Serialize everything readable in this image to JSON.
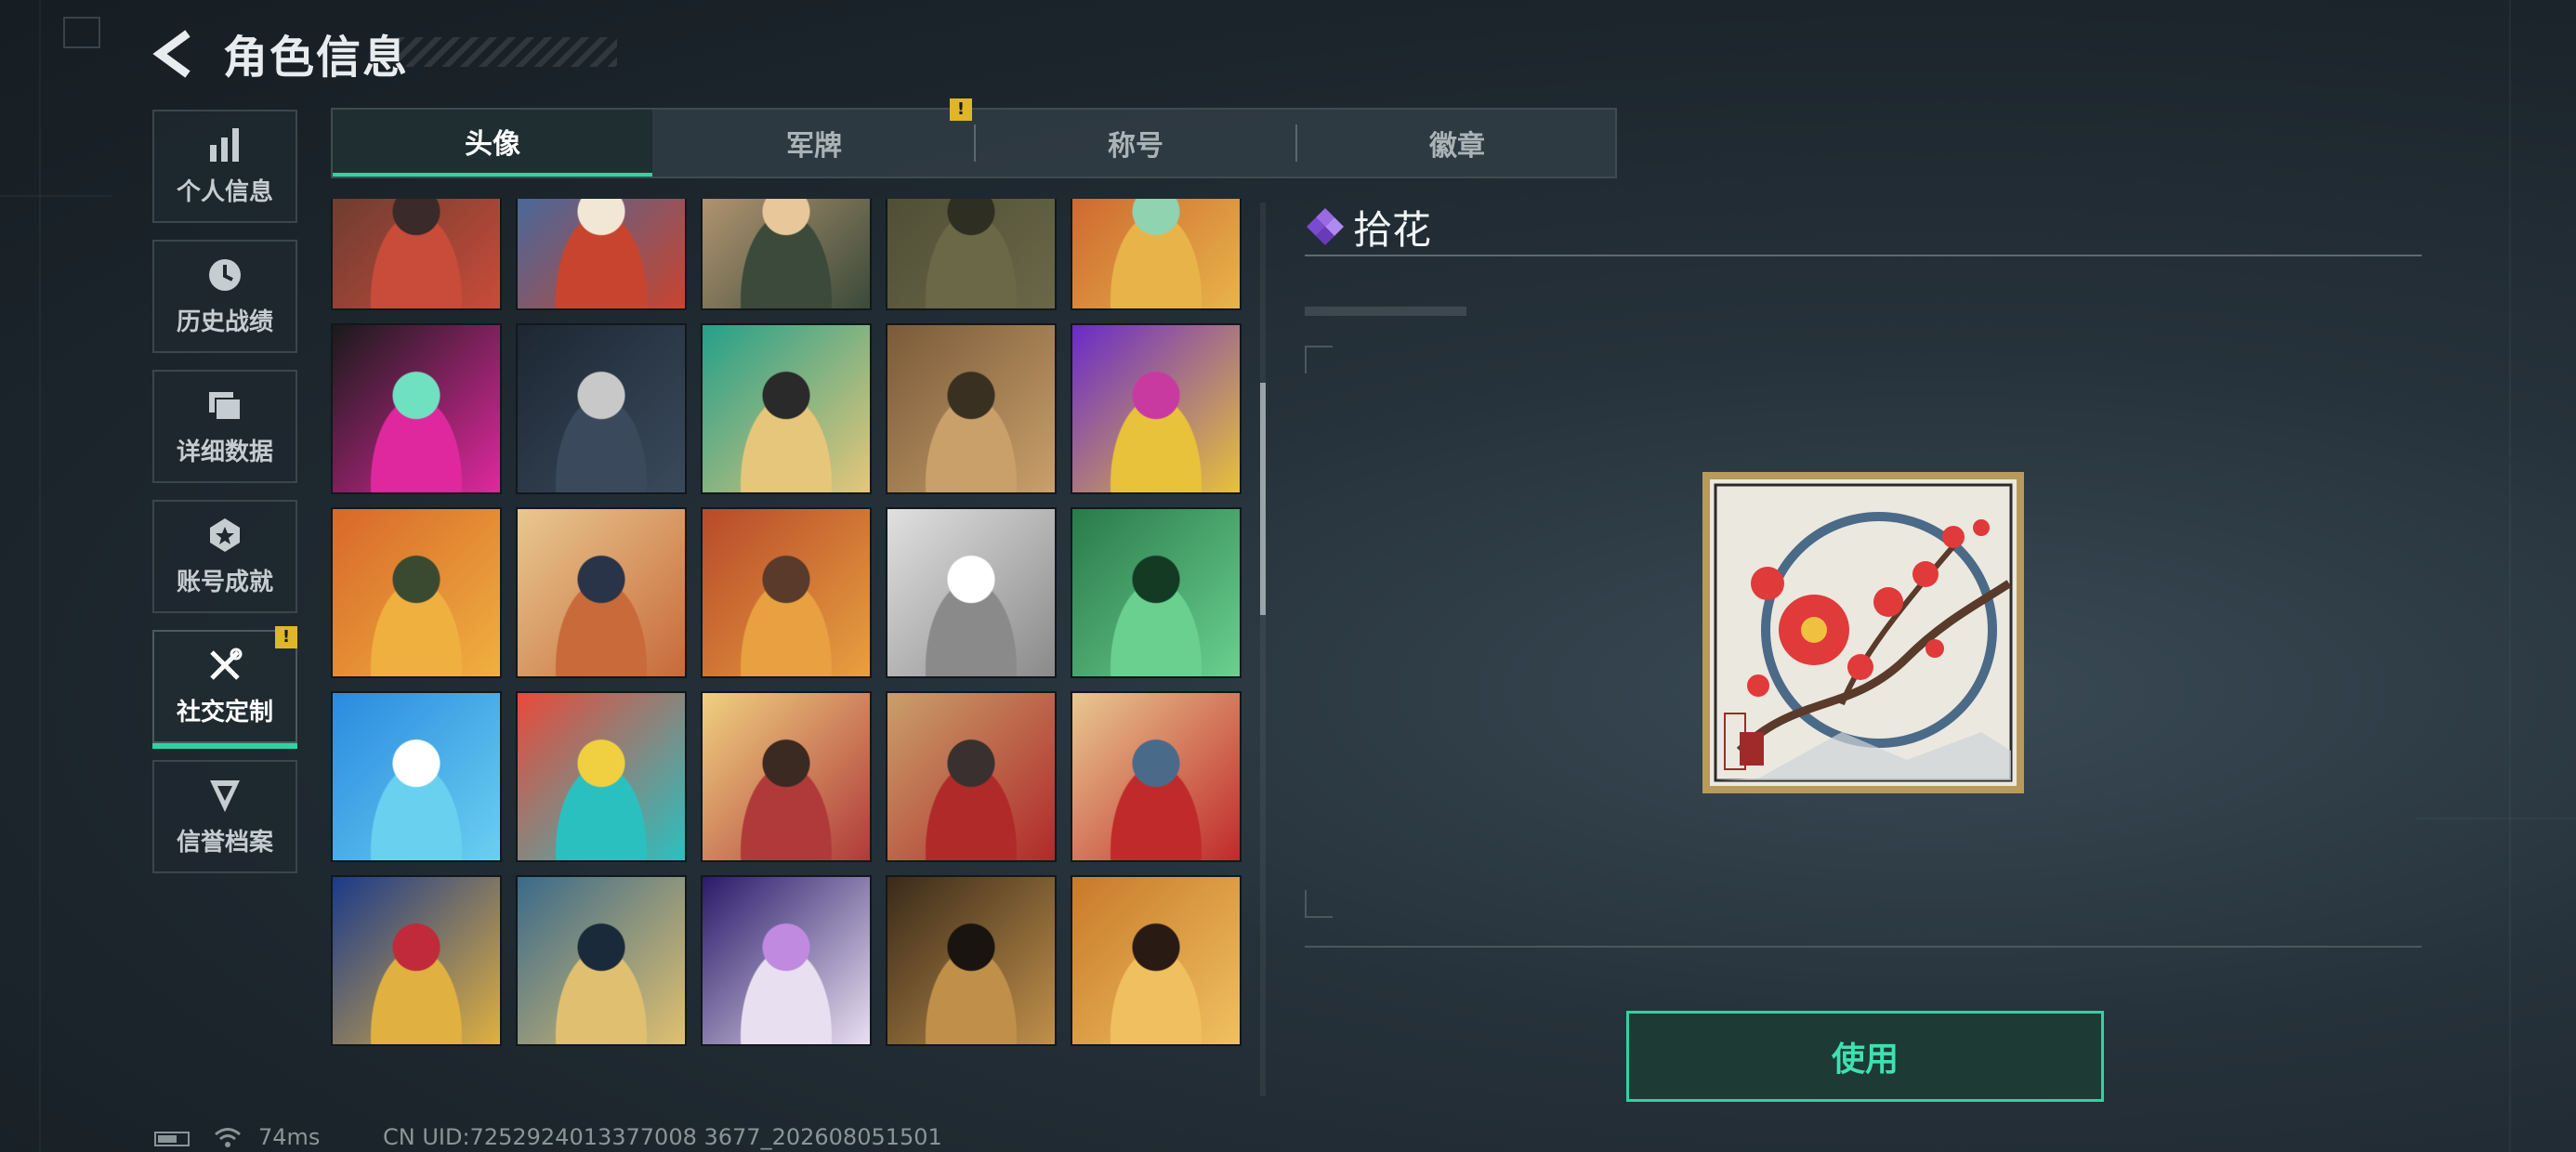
{
  "header": {
    "title": "角色信息",
    "back_icon": "chevron-left-icon"
  },
  "sidebar": {
    "items": [
      {
        "label": "个人信息",
        "icon": "bar-chart-icon",
        "active": false,
        "warning": false
      },
      {
        "label": "历史战绩",
        "icon": "history-clock-icon",
        "active": false,
        "warning": false
      },
      {
        "label": "详细数据",
        "icon": "folder-icon",
        "active": false,
        "warning": false
      },
      {
        "label": "账号成就",
        "icon": "achievement-badge-icon",
        "active": false,
        "warning": false
      },
      {
        "label": "社交定制",
        "icon": "tools-icon",
        "active": true,
        "warning": true
      },
      {
        "label": "信誉档案",
        "icon": "reputation-shield-icon",
        "active": false,
        "warning": false
      }
    ],
    "warning_glyph": "!"
  },
  "tabs": [
    {
      "label": "头像",
      "active": true,
      "warning": false
    },
    {
      "label": "军牌",
      "active": false,
      "warning": true
    },
    {
      "label": "称号",
      "active": false,
      "warning": false
    },
    {
      "label": "徽章",
      "active": false,
      "warning": false
    }
  ],
  "avatars": [
    {
      "colors": [
        "#5b3a2e",
        "#c94b3a",
        "#3a2a2a"
      ]
    },
    {
      "colors": [
        "#2f6fb0",
        "#c9442f",
        "#f2e7d5"
      ]
    },
    {
      "colors": [
        "#c8a27a",
        "#3b4a3a",
        "#e8c79a"
      ]
    },
    {
      "colors": [
        "#4a4a32",
        "#6b6848",
        "#2e2e22"
      ]
    },
    {
      "colors": [
        "#c95a2c",
        "#e8b44a",
        "#8fd3b0"
      ]
    },
    {
      "colors": [
        "#1a1a1a",
        "#e0289e",
        "#6fe0c0"
      ]
    },
    {
      "colors": [
        "#1d2733",
        "#3a4a5c",
        "#c8c8c8"
      ]
    },
    {
      "colors": [
        "#24a08a",
        "#e6c67a",
        "#2a2a2a"
      ]
    },
    {
      "colors": [
        "#7a5a3a",
        "#c9a06a",
        "#3a3022"
      ]
    },
    {
      "colors": [
        "#6a2ac9",
        "#e8c23a",
        "#c93aa0"
      ]
    },
    {
      "colors": [
        "#d8682a",
        "#f0b040",
        "#3a4a30"
      ]
    },
    {
      "colors": [
        "#e8c890",
        "#c86a3a",
        "#2a3448"
      ]
    },
    {
      "colors": [
        "#b84a2a",
        "#e8a040",
        "#5a3a2a"
      ]
    },
    {
      "colors": [
        "#e0e0e0",
        "#8a8a8a",
        "#ffffff"
      ]
    },
    {
      "colors": [
        "#2a7a4a",
        "#6ad090",
        "#143a24"
      ]
    },
    {
      "colors": [
        "#2a8ae0",
        "#6ad0f0",
        "#ffffff"
      ]
    },
    {
      "colors": [
        "#e84a3a",
        "#2ac0c0",
        "#f0d040"
      ]
    },
    {
      "colors": [
        "#f0d080",
        "#b03a3a",
        "#3a2a22"
      ]
    },
    {
      "colors": [
        "#c9a06a",
        "#b02a2a",
        "#3a3030"
      ]
    },
    {
      "colors": [
        "#e8c890",
        "#c02a2a",
        "#4a6a8a"
      ]
    },
    {
      "colors": [
        "#1a3a8a",
        "#e0b040",
        "#c02a3a"
      ]
    },
    {
      "colors": [
        "#3a6a8a",
        "#e0c070",
        "#1a2a3a"
      ]
    },
    {
      "colors": [
        "#2a1a6a",
        "#e8e0f0",
        "#c08ae0"
      ]
    },
    {
      "colors": [
        "#3a2a1a",
        "#c0904a",
        "#1a1410"
      ]
    },
    {
      "colors": [
        "#c87a2a",
        "#f0c060",
        "#2a1a14"
      ]
    },
    {
      "colors": [
        "#3a9a6a",
        "#1a3a2a",
        "#6ae0a0"
      ]
    },
    {
      "colors": [
        "#c9a06a",
        "#e8d0a0",
        "#4a3a2a"
      ]
    },
    {
      "colors": [
        "#3a1a1a",
        "#b03a3a",
        "#1a1010"
      ]
    },
    {
      "colors": [
        "#e8e8f0",
        "#3a5a8a",
        "#c0c8d8"
      ]
    },
    {
      "colors": [
        "#8a6ad0",
        "#e0d0f0",
        "#4a3a8a"
      ]
    }
  ],
  "detail": {
    "name": "拾花",
    "rarity_icon": "purple-diamond-icon",
    "preview_name": "plum-blossom-avatar",
    "use_button": "使用"
  },
  "footer": {
    "battery_icon": "battery-icon",
    "wifi_icon": "wifi-icon",
    "ping": "74ms",
    "uid": "CN UID:7252924013377008 3677_202608051501"
  }
}
